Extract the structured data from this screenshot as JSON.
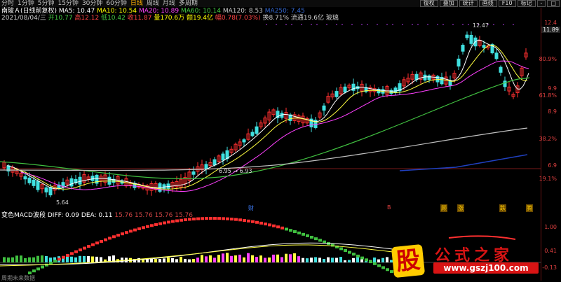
{
  "periods": {
    "items": [
      "分时",
      "1分钟",
      "5分钟",
      "15分钟",
      "30分钟",
      "60分钟",
      "日线",
      "周线",
      "月线",
      "多周期"
    ],
    "active_index": 6
  },
  "toolbar_right": [
    "復权",
    "叠加",
    "统计",
    "画线",
    "F10",
    "标记",
    "-",
    "□"
  ],
  "legend": {
    "name": "南玻Ａ(日线前复权)",
    "ma5": "MA5: 10.47",
    "ma10": "MA10: 10.54",
    "ma20": "MA20: 10.89",
    "ma60": "MA60: 10.14",
    "ma120": "MA120: 8.53",
    "ma250": "MA250: 7.45"
  },
  "info": {
    "date": "2021/08/04/三",
    "open": "开10.77",
    "high": "高12.12",
    "low": "低10.42",
    "close": "收11.87",
    "volume": "量170.6万",
    "amount": "额19.4亿",
    "change": "幅0.78(7.03%)",
    "turnover": "换8.71%",
    "float": "流通19.6亿",
    "tail": "玻璃"
  },
  "axis": {
    "ticks": [
      {
        "label": "12.4",
        "color": "#e04040"
      },
      {
        "label": "11.89",
        "color": "#ffffff",
        "tag": true
      },
      {
        "label": "80.9%",
        "color": "#e04040"
      },
      {
        "label": "9.9",
        "color": "#e04040"
      },
      {
        "label": "61.8%",
        "color": "#e04040"
      },
      {
        "label": "8.9",
        "color": "#e04040"
      },
      {
        "label": "38.2%",
        "color": "#e04040"
      },
      {
        "label": "6.9",
        "color": "#e04040"
      },
      {
        "label": "19.1%",
        "color": "#e04040"
      },
      {
        "label": "1.00",
        "color": "#e04040"
      },
      {
        "label": "0.41",
        "color": "#e04040"
      },
      {
        "label": "-0.13",
        "color": "#e04040"
      }
    ]
  },
  "annotations": {
    "high": "12.47",
    "low": "5.64",
    "mid": "6.95 → 6.93"
  },
  "bottom_labels": [
    {
      "text": "财",
      "color": "#4080ff"
    },
    {
      "text": "B",
      "color": "#e04040"
    },
    {
      "text": "顾",
      "color": "#ffcc00",
      "bg": "#6a4a00"
    },
    {
      "text": "涨",
      "color": "#ffcc00",
      "bg": "#6a4a00"
    },
    {
      "text": "跌",
      "color": "#ffcc00",
      "bg": "#6a4a00"
    },
    {
      "text": "腾",
      "color": "#ffcc00",
      "bg": "#6a4a00"
    }
  ],
  "macd": {
    "title": "变色MACD波段",
    "diff": "DIFF: 0.09",
    "dea": "DEA: 0.11",
    "extra": "15.76  15.76  15.76  15.76"
  },
  "bottom_text": "周期未来数据",
  "logo": {
    "char": "股",
    "title": "公式之家",
    "url": "www.gszj100.com"
  },
  "colors": {
    "up": "#ff3030",
    "down": "#40e0e0",
    "ma5": "#ffffff",
    "ma10": "#ffff40",
    "ma20": "#ff40ff",
    "ma60": "#40c040",
    "ma120": "#c0c0c0",
    "ma250": "#2040c0"
  }
}
